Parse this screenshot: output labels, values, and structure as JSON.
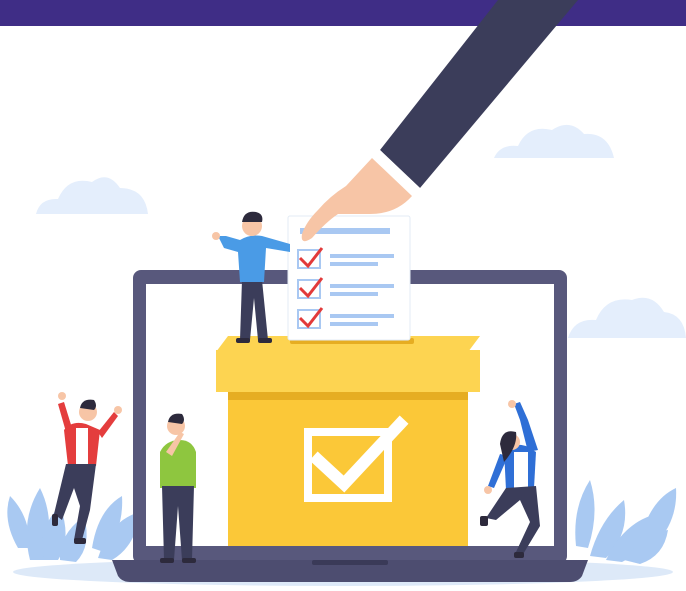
{
  "palette": {
    "top_band": "#3f2d86",
    "sky_cloud": "#e4eefc",
    "ground_shadow": "#dde9f8",
    "laptop_frame": "#58587c",
    "laptop_base": "#4d4d70",
    "screen": "#ffffff",
    "ballot_box_front": "#fbc838",
    "ballot_box_lid": "#fdd451",
    "ballot_box_shade": "#e6ad22",
    "checkmark": "#ffffff",
    "ballot_paper": "#ffffff",
    "ballot_check": "#e23a3a",
    "ballot_line": "#a9c8f2",
    "sleeve": "#3b3d5a",
    "skin": "#f7c5a6",
    "leaf": "#a9c9f2"
  },
  "icons": {
    "ballot_box": "ballot-box-icon",
    "checkmark": "checkmark-icon",
    "laptop": "laptop-icon"
  },
  "ballot": {
    "checked_items": 3
  }
}
